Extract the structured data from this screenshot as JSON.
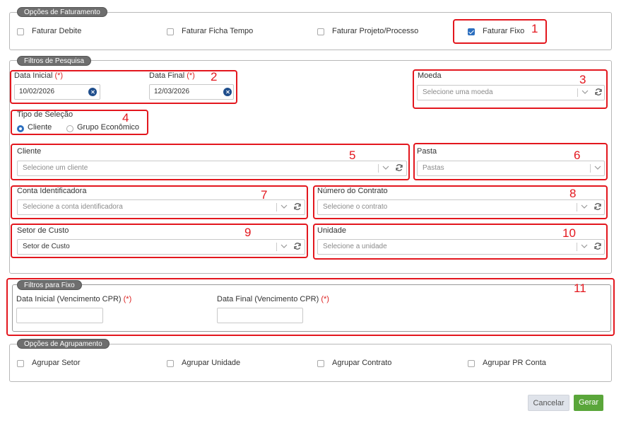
{
  "billing_options": {
    "legend": "Opções de Faturamento",
    "items": [
      {
        "label": "Faturar Debite",
        "checked": false
      },
      {
        "label": "Faturar Ficha Tempo",
        "checked": false
      },
      {
        "label": "Faturar Projeto/Processo",
        "checked": false
      },
      {
        "label": "Faturar Fixo",
        "checked": true
      }
    ]
  },
  "search_filters": {
    "legend": "Filtros de Pesquisa",
    "date_start": {
      "label": "Data Inicial",
      "required": "(*)",
      "value": "10/02/2026"
    },
    "date_end": {
      "label": "Data Final",
      "required": "(*)",
      "value": "12/03/2026"
    },
    "currency": {
      "label": "Moeda",
      "placeholder": "Selecione uma moeda"
    },
    "selection_type": {
      "label": "Tipo de Seleção",
      "options": [
        "Cliente",
        "Grupo Econômico"
      ],
      "selected": "Cliente"
    },
    "client": {
      "label": "Cliente",
      "placeholder": "Selecione um cliente"
    },
    "folder": {
      "label": "Pasta",
      "placeholder": "Pastas"
    },
    "account": {
      "label": "Conta Identificadora",
      "placeholder": "Selecione a conta identificadora"
    },
    "contract": {
      "label": "Número do Contrato",
      "placeholder": "Selecione o contrato"
    },
    "cost_sector": {
      "label": "Setor de Custo",
      "placeholder": "Setor de Custo"
    },
    "unit": {
      "label": "Unidade",
      "placeholder": "Selecione a unidade"
    }
  },
  "fixed_filters": {
    "legend": "Filtros para Fixo",
    "date_start": {
      "label": "Data Inicial (Vencimento CPR)",
      "required": "(*)",
      "value": ""
    },
    "date_end": {
      "label": "Data Final (Vencimento CPR)",
      "required": "(*)",
      "value": ""
    }
  },
  "grouping": {
    "legend": "Opções de Agrupamento",
    "items": [
      {
        "label": "Agrupar Setor",
        "checked": false
      },
      {
        "label": "Agrupar Unidade",
        "checked": false
      },
      {
        "label": "Agrupar Contrato",
        "checked": false
      },
      {
        "label": "Agrupar PR Conta",
        "checked": false
      }
    ]
  },
  "actions": {
    "cancel": "Cancelar",
    "generate": "Gerar"
  },
  "annotations": [
    "1",
    "2",
    "3",
    "4",
    "5",
    "6",
    "7",
    "8",
    "9",
    "10",
    "11"
  ],
  "colors": {
    "annotation": "#e3171e",
    "accent": "#2c6fbf",
    "generate": "#5aa63a",
    "cancel_bg": "#dfe3ea"
  }
}
